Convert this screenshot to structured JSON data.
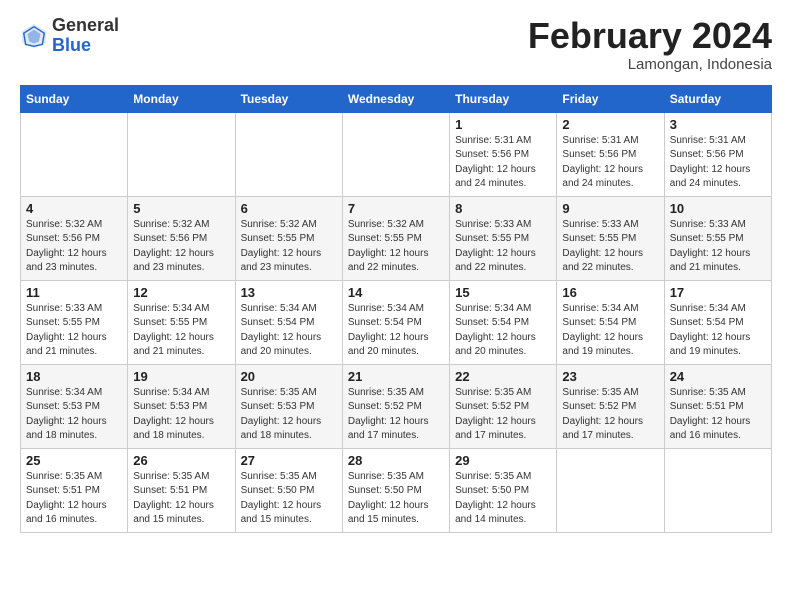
{
  "header": {
    "logo_general": "General",
    "logo_blue": "Blue",
    "month_title": "February 2024",
    "location": "Lamongan, Indonesia"
  },
  "weekdays": [
    "Sunday",
    "Monday",
    "Tuesday",
    "Wednesday",
    "Thursday",
    "Friday",
    "Saturday"
  ],
  "weeks": [
    [
      {
        "day": "",
        "info": ""
      },
      {
        "day": "",
        "info": ""
      },
      {
        "day": "",
        "info": ""
      },
      {
        "day": "",
        "info": ""
      },
      {
        "day": "1",
        "info": "Sunrise: 5:31 AM\nSunset: 5:56 PM\nDaylight: 12 hours\nand 24 minutes."
      },
      {
        "day": "2",
        "info": "Sunrise: 5:31 AM\nSunset: 5:56 PM\nDaylight: 12 hours\nand 24 minutes."
      },
      {
        "day": "3",
        "info": "Sunrise: 5:31 AM\nSunset: 5:56 PM\nDaylight: 12 hours\nand 24 minutes."
      }
    ],
    [
      {
        "day": "4",
        "info": "Sunrise: 5:32 AM\nSunset: 5:56 PM\nDaylight: 12 hours\nand 23 minutes."
      },
      {
        "day": "5",
        "info": "Sunrise: 5:32 AM\nSunset: 5:56 PM\nDaylight: 12 hours\nand 23 minutes."
      },
      {
        "day": "6",
        "info": "Sunrise: 5:32 AM\nSunset: 5:55 PM\nDaylight: 12 hours\nand 23 minutes."
      },
      {
        "day": "7",
        "info": "Sunrise: 5:32 AM\nSunset: 5:55 PM\nDaylight: 12 hours\nand 22 minutes."
      },
      {
        "day": "8",
        "info": "Sunrise: 5:33 AM\nSunset: 5:55 PM\nDaylight: 12 hours\nand 22 minutes."
      },
      {
        "day": "9",
        "info": "Sunrise: 5:33 AM\nSunset: 5:55 PM\nDaylight: 12 hours\nand 22 minutes."
      },
      {
        "day": "10",
        "info": "Sunrise: 5:33 AM\nSunset: 5:55 PM\nDaylight: 12 hours\nand 21 minutes."
      }
    ],
    [
      {
        "day": "11",
        "info": "Sunrise: 5:33 AM\nSunset: 5:55 PM\nDaylight: 12 hours\nand 21 minutes."
      },
      {
        "day": "12",
        "info": "Sunrise: 5:34 AM\nSunset: 5:55 PM\nDaylight: 12 hours\nand 21 minutes."
      },
      {
        "day": "13",
        "info": "Sunrise: 5:34 AM\nSunset: 5:54 PM\nDaylight: 12 hours\nand 20 minutes."
      },
      {
        "day": "14",
        "info": "Sunrise: 5:34 AM\nSunset: 5:54 PM\nDaylight: 12 hours\nand 20 minutes."
      },
      {
        "day": "15",
        "info": "Sunrise: 5:34 AM\nSunset: 5:54 PM\nDaylight: 12 hours\nand 20 minutes."
      },
      {
        "day": "16",
        "info": "Sunrise: 5:34 AM\nSunset: 5:54 PM\nDaylight: 12 hours\nand 19 minutes."
      },
      {
        "day": "17",
        "info": "Sunrise: 5:34 AM\nSunset: 5:54 PM\nDaylight: 12 hours\nand 19 minutes."
      }
    ],
    [
      {
        "day": "18",
        "info": "Sunrise: 5:34 AM\nSunset: 5:53 PM\nDaylight: 12 hours\nand 18 minutes."
      },
      {
        "day": "19",
        "info": "Sunrise: 5:34 AM\nSunset: 5:53 PM\nDaylight: 12 hours\nand 18 minutes."
      },
      {
        "day": "20",
        "info": "Sunrise: 5:35 AM\nSunset: 5:53 PM\nDaylight: 12 hours\nand 18 minutes."
      },
      {
        "day": "21",
        "info": "Sunrise: 5:35 AM\nSunset: 5:52 PM\nDaylight: 12 hours\nand 17 minutes."
      },
      {
        "day": "22",
        "info": "Sunrise: 5:35 AM\nSunset: 5:52 PM\nDaylight: 12 hours\nand 17 minutes."
      },
      {
        "day": "23",
        "info": "Sunrise: 5:35 AM\nSunset: 5:52 PM\nDaylight: 12 hours\nand 17 minutes."
      },
      {
        "day": "24",
        "info": "Sunrise: 5:35 AM\nSunset: 5:51 PM\nDaylight: 12 hours\nand 16 minutes."
      }
    ],
    [
      {
        "day": "25",
        "info": "Sunrise: 5:35 AM\nSunset: 5:51 PM\nDaylight: 12 hours\nand 16 minutes."
      },
      {
        "day": "26",
        "info": "Sunrise: 5:35 AM\nSunset: 5:51 PM\nDaylight: 12 hours\nand 15 minutes."
      },
      {
        "day": "27",
        "info": "Sunrise: 5:35 AM\nSunset: 5:50 PM\nDaylight: 12 hours\nand 15 minutes."
      },
      {
        "day": "28",
        "info": "Sunrise: 5:35 AM\nSunset: 5:50 PM\nDaylight: 12 hours\nand 15 minutes."
      },
      {
        "day": "29",
        "info": "Sunrise: 5:35 AM\nSunset: 5:50 PM\nDaylight: 12 hours\nand 14 minutes."
      },
      {
        "day": "",
        "info": ""
      },
      {
        "day": "",
        "info": ""
      }
    ]
  ]
}
